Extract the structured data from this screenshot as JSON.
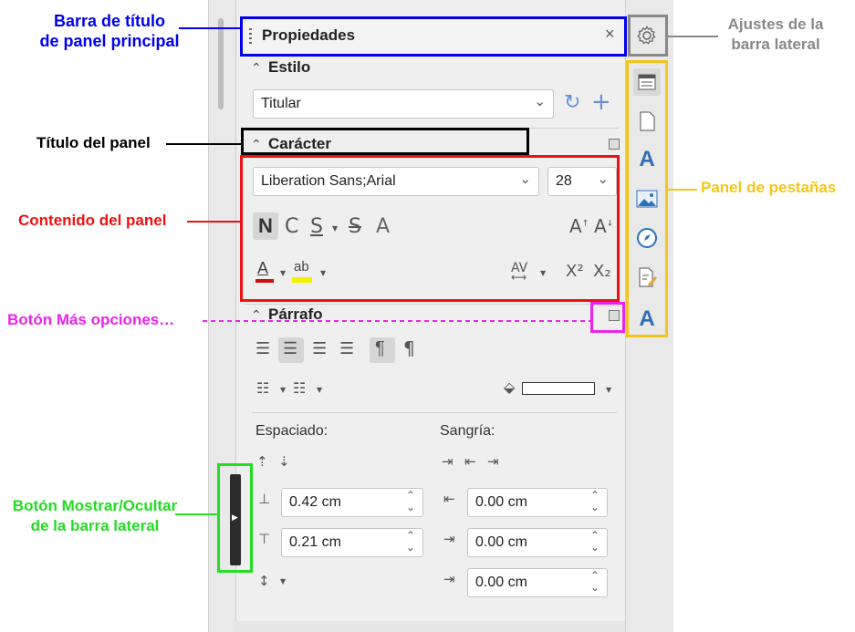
{
  "annotations": {
    "main_title_bar": "Barra de título\nde panel principal",
    "panel_title": "Título del panel",
    "panel_content": "Contenido del panel",
    "more_options": "Botón Más opciones…",
    "toggle_sidebar": "Botón Mostrar/Ocultar\nde la barra lateral",
    "sidebar_settings": "Ajustes de la\nbarra lateral",
    "tab_bar": "Panel de pestañas"
  },
  "colors": {
    "blue": "#0000ee",
    "black": "#000000",
    "red": "#ee1111",
    "magenta": "#ee22ee",
    "green": "#22dd22",
    "gray": "#888888",
    "yellow": "#f5c518"
  },
  "deck": {
    "title": "Propiedades",
    "close_glyph": "×"
  },
  "panels": {
    "style": {
      "title": "Estilo",
      "style_value": "Titular"
    },
    "character": {
      "title": "Carácter",
      "font_name": "Liberation Sans;Arial",
      "font_size": "28",
      "bold": "N",
      "italic": "C",
      "underline": "S",
      "strike": "S",
      "shadow": "A",
      "superscript": "X²",
      "subscript": "X₂"
    },
    "paragraph": {
      "title": "Párrafo",
      "spacing_label": "Espaciado:",
      "indent_label": "Sangría:",
      "space_above": "0.42 cm",
      "space_below": "0.21 cm",
      "indent_before": "0.00 cm",
      "indent_after": "0.00 cm",
      "first_line_indent": "0.00 cm"
    }
  },
  "tabbar_icons": [
    "properties-icon",
    "page-icon",
    "styles-icon",
    "gallery-icon",
    "navigator-icon",
    "manage-changes-icon",
    "design-icon"
  ]
}
